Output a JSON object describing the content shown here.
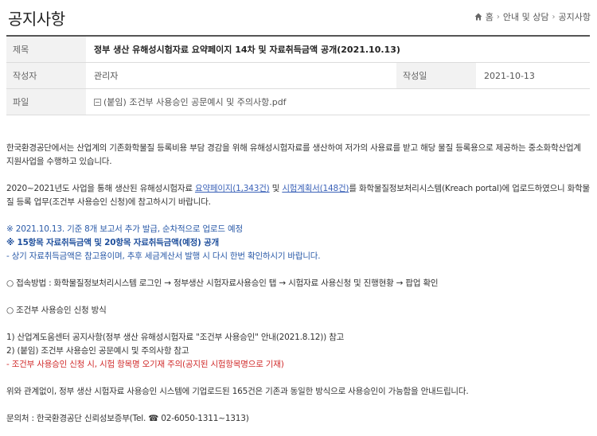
{
  "header": {
    "title": "공지사항",
    "breadcrumb": [
      "홈",
      "안내 및 상담",
      "공지사항"
    ]
  },
  "post": {
    "title_label": "제목",
    "title": "정부 생산 유해성시험자료 요약페이지 14차 및 자료취득금액 공개(2021.10.13)",
    "author_label": "작성자",
    "author": "관리자",
    "date_label": "작성일",
    "date": "2021-10-13",
    "file_label": "파일",
    "file_name": "(붙임) 조건부 사용승인 공문예시 및 주의사항.pdf"
  },
  "body": {
    "para1": "한국환경공단에서는 산업계의 기존화학물질 등록비용 부담 경감을 위해 유해성시험자료를 생산하여 저가의 사용료를 받고 해당 물질 등록용으로 제공하는 중소화학산업계 지원사업을 수행하고 있습니다.",
    "para2_pre": "2020~2021년도 사업을 통해 생산된 유해성시험자료 ",
    "para2_link1": "요약페이지(1,343건)",
    "para2_mid": " 및 ",
    "para2_link2": "시험계획서(148건)",
    "para2_post": "를 화학물질정보처리시스템(Kreach portal)에 업로드하였으니 화학물질 등록 업무(조건부 사용승인 신청)에 참고하시기 바랍니다.",
    "note1": "※ 2021.10.13. 기준 8개 보고서 추가 발급, 순차적으로 업로드 예정",
    "note2": "※ 15항목 자료취득금액 및 20항목 자료취득금액(예정) 공개",
    "note3": " - 상기 자료취득금액은 참고용이며, 추후 세금계산서 발행 시 다시 한번 확인하시기 바랍니다.",
    "access": "○ 접속방법 : 화학물질정보처리시스템 로그인 → 정부생산 시험자료사용승인 탭 → 시험자료 사용신청 및 진행현황 → 팝업 확인",
    "approval_title": "○ 조건부 사용승인 신청 방식",
    "step1": "1) 산업계도움센터 공지사항(정부 생산 유해성시험자료 \"조건부 사용승인\" 안내(2021.8.12)) 참고",
    "step2": "2) (붙임) 조건부 사용승인 공문예시 및 주의사항 참고",
    "warning": " - 조건부 사용승인 신청 시, 시험 항목명 오기재 주의(공지된 시험항목명으로 기재)",
    "para3": "위와 관계없이, 정부 생산 시험자료 사용승인 시스템에 기업로드된 165건은 기존과 동일한 방식으로 사용승인이 가능함을 안내드립니다.",
    "contact": "문의처 : 한국환경공단 신뢰성보증부(Tel. ☎ 02-6050-1311~1313)"
  }
}
